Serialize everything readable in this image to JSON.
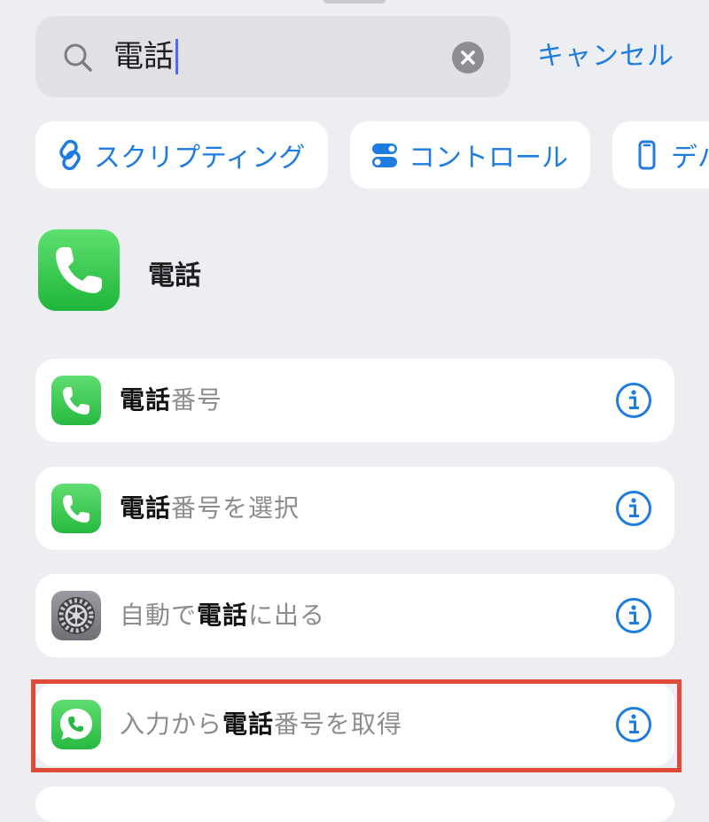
{
  "search": {
    "query": "電話",
    "cancel_label": "キャンセル"
  },
  "categories": [
    {
      "label": "スクリプティング",
      "icon": "link-icon"
    },
    {
      "label": "コントロール",
      "icon": "toggle-icon"
    },
    {
      "label": "デバ",
      "icon": "phone-device-icon"
    }
  ],
  "app_section": {
    "title": "電話",
    "icon": "phone-app-icon"
  },
  "actions": [
    {
      "pre": "",
      "match": "電話",
      "post": "番号",
      "icon": "phone-icon"
    },
    {
      "pre": "",
      "match": "電話",
      "post": "番号を選択",
      "icon": "phone-icon"
    },
    {
      "pre": "自動で",
      "match": "電話",
      "post": "に出る",
      "icon": "settings-gear-icon"
    },
    {
      "pre": "入力から",
      "match": "電話",
      "post": "番号を取得",
      "icon": "phone-bubble-icon",
      "highlighted": true
    }
  ],
  "colors": {
    "accent": "#1e7be0",
    "highlight": "#e04a38",
    "phone_green": "#28b942"
  }
}
